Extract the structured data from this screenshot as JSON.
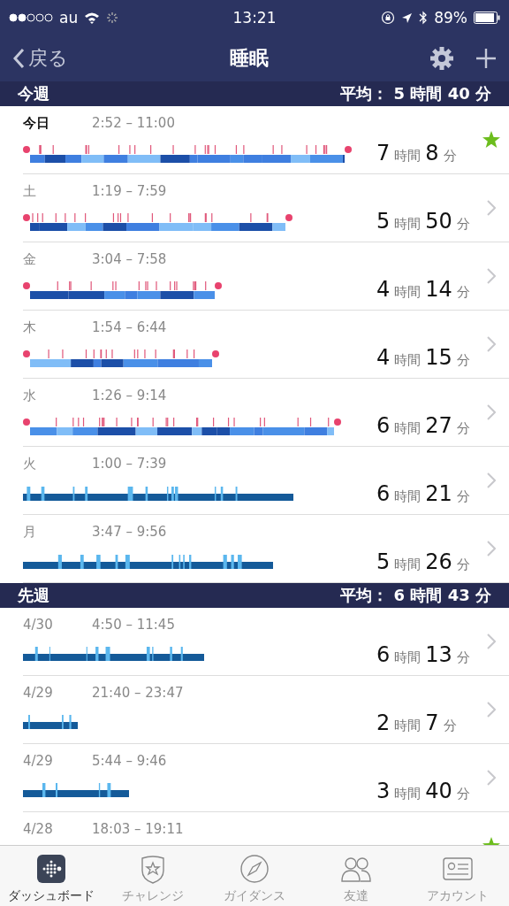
{
  "status_bar": {
    "carrier": "au",
    "time": "13:21",
    "battery": "89%"
  },
  "nav": {
    "back": "戻る",
    "title": "睡眠"
  },
  "sections": [
    {
      "title": "今週",
      "average_label": "平均：",
      "average_hours": "5",
      "hours_unit": "時間",
      "average_minutes": "40",
      "minutes_unit": "分",
      "nights": [
        {
          "day": "今日",
          "today": true,
          "time": "2:52 – 11:00",
          "hours": "7",
          "hours_unit": "時間",
          "minutes": "8",
          "minutes_unit": "分",
          "kind": "stages",
          "starred": true
        },
        {
          "day": "土",
          "today": false,
          "time": "1:19 – 7:59",
          "hours": "5",
          "hours_unit": "時間",
          "minutes": "50",
          "minutes_unit": "分",
          "kind": "stages",
          "starred": false
        },
        {
          "day": "金",
          "today": false,
          "time": "3:04 – 7:58",
          "hours": "4",
          "hours_unit": "時間",
          "minutes": "14",
          "minutes_unit": "分",
          "kind": "stages",
          "starred": false
        },
        {
          "day": "木",
          "today": false,
          "time": "1:54 – 6:44",
          "hours": "4",
          "hours_unit": "時間",
          "minutes": "15",
          "minutes_unit": "分",
          "kind": "stages",
          "starred": false
        },
        {
          "day": "水",
          "today": false,
          "time": "1:26 – 9:14",
          "hours": "6",
          "hours_unit": "時間",
          "minutes": "27",
          "minutes_unit": "分",
          "kind": "stages",
          "starred": false
        },
        {
          "day": "火",
          "today": false,
          "time": "1:00 – 7:39",
          "hours": "6",
          "hours_unit": "時間",
          "minutes": "21",
          "minutes_unit": "分",
          "kind": "classic",
          "starred": false
        },
        {
          "day": "月",
          "today": false,
          "time": "3:47 – 9:56",
          "hours": "5",
          "hours_unit": "時間",
          "minutes": "26",
          "minutes_unit": "分",
          "kind": "classic",
          "starred": false
        }
      ]
    },
    {
      "title": "先週",
      "average_label": "平均：",
      "average_hours": "6",
      "hours_unit": "時間",
      "average_minutes": "43",
      "minutes_unit": "分",
      "nights": [
        {
          "day": "4/30",
          "today": false,
          "time": "4:50 – 11:45",
          "hours": "6",
          "hours_unit": "時間",
          "minutes": "13",
          "minutes_unit": "分",
          "kind": "classic",
          "starred": false
        },
        {
          "day": "4/29",
          "today": false,
          "time": "21:40 – 23:47",
          "hours": "2",
          "hours_unit": "時間",
          "minutes": "7",
          "minutes_unit": "分",
          "kind": "classic",
          "starred": false
        },
        {
          "day": "4/29",
          "today": false,
          "time": "5:44 – 9:46",
          "hours": "3",
          "hours_unit": "時間",
          "minutes": "40",
          "minutes_unit": "分",
          "kind": "classic",
          "starred": false
        },
        {
          "day": "4/28",
          "today": false,
          "time": "18:03 – 19:11",
          "starred": true
        }
      ]
    }
  ],
  "tabs": [
    {
      "label": "ダッシュボード",
      "selected": true
    },
    {
      "label": "チャレンジ",
      "selected": false
    },
    {
      "label": "ガイダンス",
      "selected": false
    },
    {
      "label": "友達",
      "selected": false
    },
    {
      "label": "アカウント",
      "selected": false
    }
  ]
}
